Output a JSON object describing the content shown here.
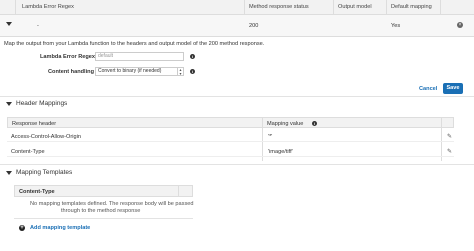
{
  "responses_table": {
    "columns": [
      "Lambda Error Regex",
      "Method response status",
      "Output model",
      "Default mapping"
    ],
    "row": {
      "regex": "-",
      "status": "200",
      "output_model": "",
      "default_mapping": "Yes"
    }
  },
  "detail": {
    "description": "Map the output from your Lambda function to the headers and output model of the 200 method response.",
    "regex_label": "Lambda Error Regex",
    "regex_placeholder": "default",
    "content_handling_label": "Content handling",
    "content_handling_value": "Convert to binary (if needed)",
    "cancel_label": "Cancel",
    "save_label": "Save"
  },
  "header_mappings": {
    "title": "Header Mappings",
    "columns": [
      "Response header",
      "Mapping value"
    ],
    "rows": [
      {
        "header": "Access-Control-Allow-Origin",
        "value": "'*'"
      },
      {
        "header": "Content-Type",
        "value": "'image/tiff'"
      }
    ]
  },
  "mapping_templates": {
    "title": "Mapping Templates",
    "column": "Content-Type",
    "empty_line1": "No mapping templates defined. The response body will be passed",
    "empty_line2": "through to the method response",
    "add_label": "Add mapping template"
  }
}
